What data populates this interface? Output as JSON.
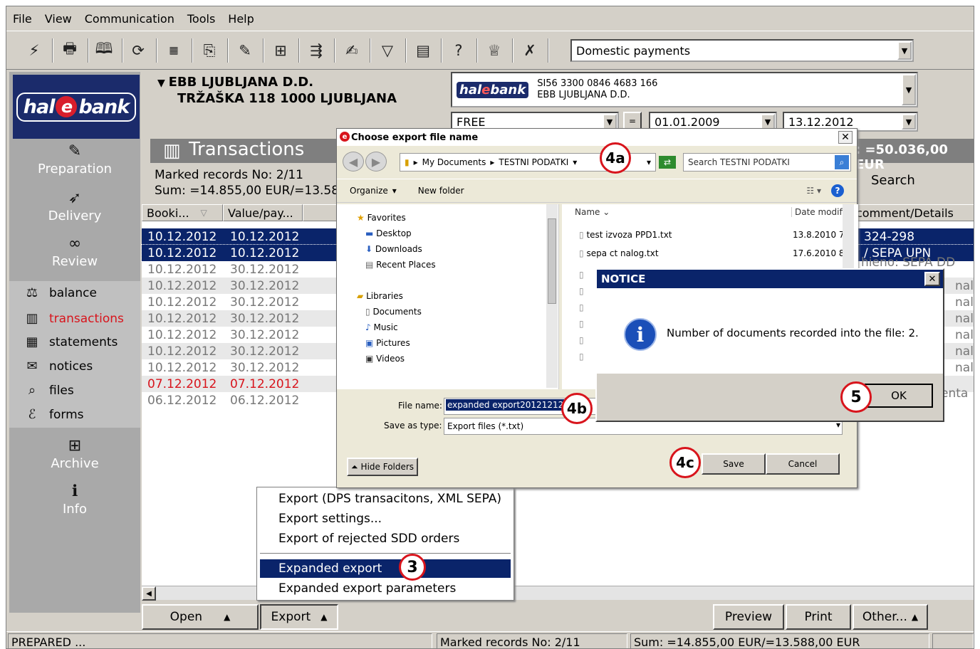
{
  "menu": [
    "File",
    "View",
    "Communication",
    "Tools",
    "Help"
  ],
  "toolbar": {
    "payment_type": "Domestic payments"
  },
  "account": {
    "name": "EBB LJUBLJANA D.D.",
    "address": "TRŽAŠKA 118 1000 LJUBLJANA",
    "iban": "SI56 3300 0846 4683 166",
    "bank_name": "EBB LJUBLJANA D.D.",
    "filter": "FREE",
    "date_from": "01.01.2009",
    "date_to": "13.12.2012"
  },
  "logo": {
    "pre": "hal",
    "e": "e",
    "post": "bank"
  },
  "nav": {
    "preparation": "Preparation",
    "delivery": "Delivery",
    "review": "Review",
    "balance": "balance",
    "transactions": "transactions",
    "statements": "statements",
    "notices": "notices",
    "files": "files",
    "forms": "forms",
    "archive": "Archive",
    "info": "Info"
  },
  "transactions": {
    "title": "Transactions",
    "marked": "Marked records No: 2/11",
    "sum": "Sum: =14.855,00 EUR/=13.588,0",
    "total": ": =50.036,00 EUR",
    "search": "Search"
  },
  "columns": {
    "booking": "Booki...",
    "value": "Value/pay...",
    "comment": "comment/Details"
  },
  "rows": [
    {
      "b": "10.12.2012",
      "v": "10.12.2012",
      "c": "324-298"
    },
    {
      "b": "10.12.2012",
      "v": "10.12.2012",
      "c": "/ SEPA UPN"
    },
    {
      "b": "10.12.2012",
      "v": "30.12.2012",
      "c": "hieno: SEPA DD nalo"
    },
    {
      "b": "10.12.2012",
      "v": "30.12.2012",
      "c": "nalo"
    },
    {
      "b": "10.12.2012",
      "v": "30.12.2012",
      "c": "nalo"
    },
    {
      "b": "10.12.2012",
      "v": "30.12.2012",
      "c": "nalo"
    },
    {
      "b": "10.12.2012",
      "v": "30.12.2012",
      "c": "nalo"
    },
    {
      "b": "10.12.2012",
      "v": "30.12.2012",
      "c": "nalo"
    },
    {
      "b": "10.12.2012",
      "v": "30.12.2012",
      "c": "nalo"
    },
    {
      "b": "07.12.2012",
      "v": "07.12.2012",
      "c": ""
    },
    {
      "b": "06.12.2012",
      "v": "06.12.2012",
      "c": "enta l"
    }
  ],
  "bottom": {
    "open": "Open",
    "export": "Export",
    "preview": "Preview",
    "print": "Print",
    "other": "Other..."
  },
  "status": {
    "state": "PREPARED ...",
    "marked": "Marked records No: 2/11",
    "sum": "Sum: =14.855,00 EUR/=13.588,00 EUR"
  },
  "export_menu": {
    "dps": "Export (DPS transacitons, XML SEPA)",
    "settings": "Export settings...",
    "rejected": "Export of rejected SDD orders",
    "expanded": "Expanded export",
    "expanded_params": "Expanded export parameters"
  },
  "dialog": {
    "title": "Choose export file name",
    "path1": "My Documents",
    "path2": "TESTNI PODATKI",
    "search": "Search TESTNI PODATKI",
    "organize": "Organize",
    "new_folder": "New folder",
    "tree": [
      "Favorites",
      "Desktop",
      "Downloads",
      "Recent Places",
      "Libraries",
      "Documents",
      "Music",
      "Pictures",
      "Videos"
    ],
    "col_name": "Name",
    "col_date": "Date modifi",
    "files": [
      {
        "n": "test izvoza PPD1.txt",
        "d": "13.8.2010 7"
      },
      {
        "n": "sepa ct nalog.txt",
        "d": "17.6.2010 8"
      }
    ],
    "file_name_label": "File name:",
    "file_name": "expanded export20121212",
    "type_label": "Save as type:",
    "type": "Export files (*.txt)",
    "hide": "Hide Folders",
    "save": "Save",
    "cancel": "Cancel"
  },
  "notice": {
    "title": "NOTICE",
    "message": "Number of documents recorded into the file: 2.",
    "ok": "OK"
  },
  "callouts": {
    "c3": "3",
    "c4a": "4a",
    "c4b": "4b",
    "c4c": "4c",
    "c5": "5"
  },
  "colors": {
    "navy": "#0a246a",
    "red": "#d8141c",
    "logo_bg": "#1b2b6b"
  }
}
